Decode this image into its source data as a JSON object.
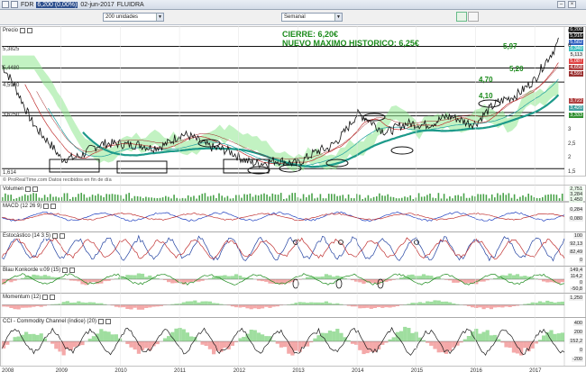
{
  "window": {
    "title": "FDR",
    "quote": "6,200 (0,00%)",
    "date": "02-jun-2017",
    "company": "FLUIDRA"
  },
  "toolbar": {
    "units_select": "200 unidades",
    "period_select": "Semanal"
  },
  "panels": {
    "price": "Precio",
    "volume": "Volumen",
    "macd": "MACD (12 26 9)",
    "stochastic": "Estocástico (14 3 5)",
    "blau": "Blau Konkorde v.09 (15)",
    "momentum": "Momentum (12)",
    "cci": "CCI - Commodity Channel (índice) (20)"
  },
  "source_note": "© ProRealTime.com  Datos recibidos en fin de día",
  "headline": {
    "line1": "CIERRE: 6,20€",
    "line2": "NUEVO MAXIMO HISTORICO: 6,25€"
  },
  "annotations": [
    "5,97",
    "5,20",
    "4,70",
    "4,10"
  ],
  "left_price_labels": [
    "5,3825",
    "5,4480",
    "4,5900",
    "3,6250",
    "1,614"
  ],
  "right_axis": {
    "price_ticks": [
      "6,5",
      "6",
      "5,5",
      "5",
      "4,5",
      "4",
      "3,5",
      "3",
      "2,5",
      "2",
      "1,5"
    ],
    "price_tags": [
      {
        "text": "6,200",
        "color": "#1a1a1a"
      },
      {
        "text": "5,916",
        "color": "#1a1a1a"
      },
      {
        "text": "5,582",
        "color": "#3060c0"
      },
      {
        "text": "5,340",
        "color": "#40c0c0"
      },
      {
        "text": "5,113",
        "color": "#ffffff"
      },
      {
        "text": "5,087",
        "color": "#e04040"
      },
      {
        "text": "4,658",
        "color": "#b04040"
      },
      {
        "text": "4,591",
        "color": "#9a3030"
      },
      {
        "text": "3,722",
        "color": "#b04040"
      },
      {
        "text": "3,420",
        "color": "#40a0a0"
      },
      {
        "text": "3,333",
        "color": "#309030"
      }
    ],
    "volume_tags": [
      "2,751",
      "3,284",
      "1,450"
    ],
    "macd_tags": [
      "0,284",
      "0,080"
    ],
    "stoch_tags": [
      "100",
      "92,13",
      "82,49",
      "0"
    ],
    "blau_tags": [
      "149,4",
      "114,2",
      "0",
      "-50,8"
    ],
    "momentum_tags": [
      "1,250"
    ],
    "cci_tags": [
      "400",
      "200",
      "152,2",
      "0",
      "-200"
    ]
  },
  "years": [
    "2008",
    "2009",
    "2010",
    "2011",
    "2012",
    "2013",
    "2014",
    "2015",
    "2016",
    "2017"
  ],
  "chart_data": {
    "type": "line",
    "title": "",
    "xlabel": "",
    "ylabel": "",
    "ylim": [
      1.5,
      6.5
    ],
    "x": [
      2008,
      2008.5,
      2009,
      2009.5,
      2010,
      2010.5,
      2011,
      2011.5,
      2012,
      2012.5,
      2013,
      2013.5,
      2014,
      2014.5,
      2015,
      2015.5,
      2016,
      2016.5,
      2017,
      2017.4
    ],
    "series": [
      {
        "name": "",
        "values": [
          5.3,
          3.4,
          1.9,
          2.3,
          2.6,
          2.3,
          2.8,
          2.5,
          2.0,
          1.8,
          1.9,
          2.3,
          3.5,
          3.0,
          3.2,
          3.4,
          3.3,
          4.1,
          4.7,
          6.2
        ]
      }
    ]
  },
  "colors": {
    "headline": "#1a8a1a",
    "price_line": "#1a1a1a",
    "cloud": "#7de87d",
    "ma_long": "#1d9a8a",
    "neg_fill": "#f29a9a",
    "pos_fill": "#8ed88e"
  }
}
